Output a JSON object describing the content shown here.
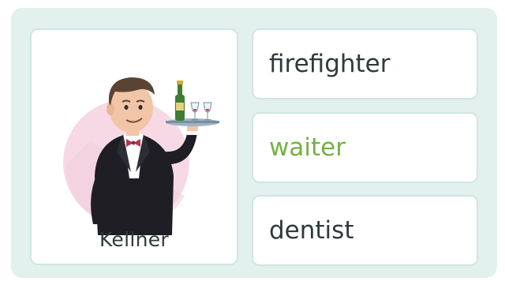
{
  "card": {
    "caption": "Kellner"
  },
  "options": [
    {
      "label": "firefighter",
      "state": "default"
    },
    {
      "label": "waiter",
      "state": "correct"
    },
    {
      "label": "dentist",
      "state": "default"
    }
  ],
  "colors": {
    "panel": "#e2f0ee",
    "card_border": "#cfe6e2",
    "text": "#2f3a3c",
    "correct": "#75b143"
  }
}
